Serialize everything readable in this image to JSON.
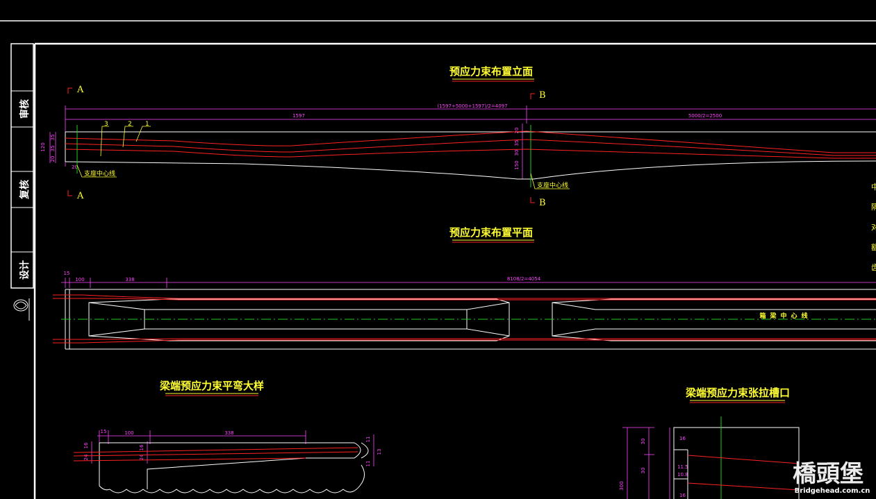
{
  "drawing": {
    "titles": {
      "elevation": "预应力束布置立面",
      "plan": "预应力束布置平面",
      "bend_detail": "梁端预应力束平弯大样",
      "anchor_slot": "梁端预应力束张拉槽口"
    },
    "side_block": {
      "review": "审核",
      "recheck": "复核",
      "design": "设计"
    },
    "section_marks": {
      "a1": "A",
      "a2": "A",
      "b1": "B",
      "b2": "B"
    },
    "elevation": {
      "dim_total": "(1597+5000+1597)/2=4097",
      "dim_left": "1597",
      "dim_right": "5000/2=2500",
      "tendon_labels": [
        "3",
        "2",
        "1"
      ],
      "left_heights": [
        "120",
        "20",
        "35",
        "35"
      ],
      "left_small": "20",
      "support_left": "支座中心线",
      "support_right": "支座中心线",
      "mid_dims": [
        "20",
        "35",
        "30",
        "150"
      ]
    },
    "plan": {
      "dims": [
        "15",
        "100",
        "338",
        "8108/2=4054"
      ],
      "centerline": "箱梁中心线"
    },
    "bend_detail": {
      "top_dims": [
        "15",
        "100",
        "338"
      ],
      "left_dims": [
        "16",
        "24",
        "16",
        "24"
      ],
      "right_dims": [
        "11",
        "13",
        "11"
      ]
    },
    "anchor_slot": {
      "left_dims": [
        "30",
        "30",
        "300"
      ],
      "inner_dims": [
        "16",
        "11.5",
        "10.8",
        "16"
      ]
    },
    "right_edge_fragments": [
      "中",
      "隔",
      "对",
      "额",
      "齿"
    ],
    "watermark": {
      "main": "橋頭堡",
      "sub": "Bridgehead.com.cn"
    },
    "colors": {
      "frame": "#ffffff",
      "title": "#ffff33",
      "underline": "#ff2222",
      "dimension": "#ff44ff",
      "tendon": "#ff2222",
      "centerline": "#22cc22",
      "section_mark": "#ff2222"
    }
  }
}
